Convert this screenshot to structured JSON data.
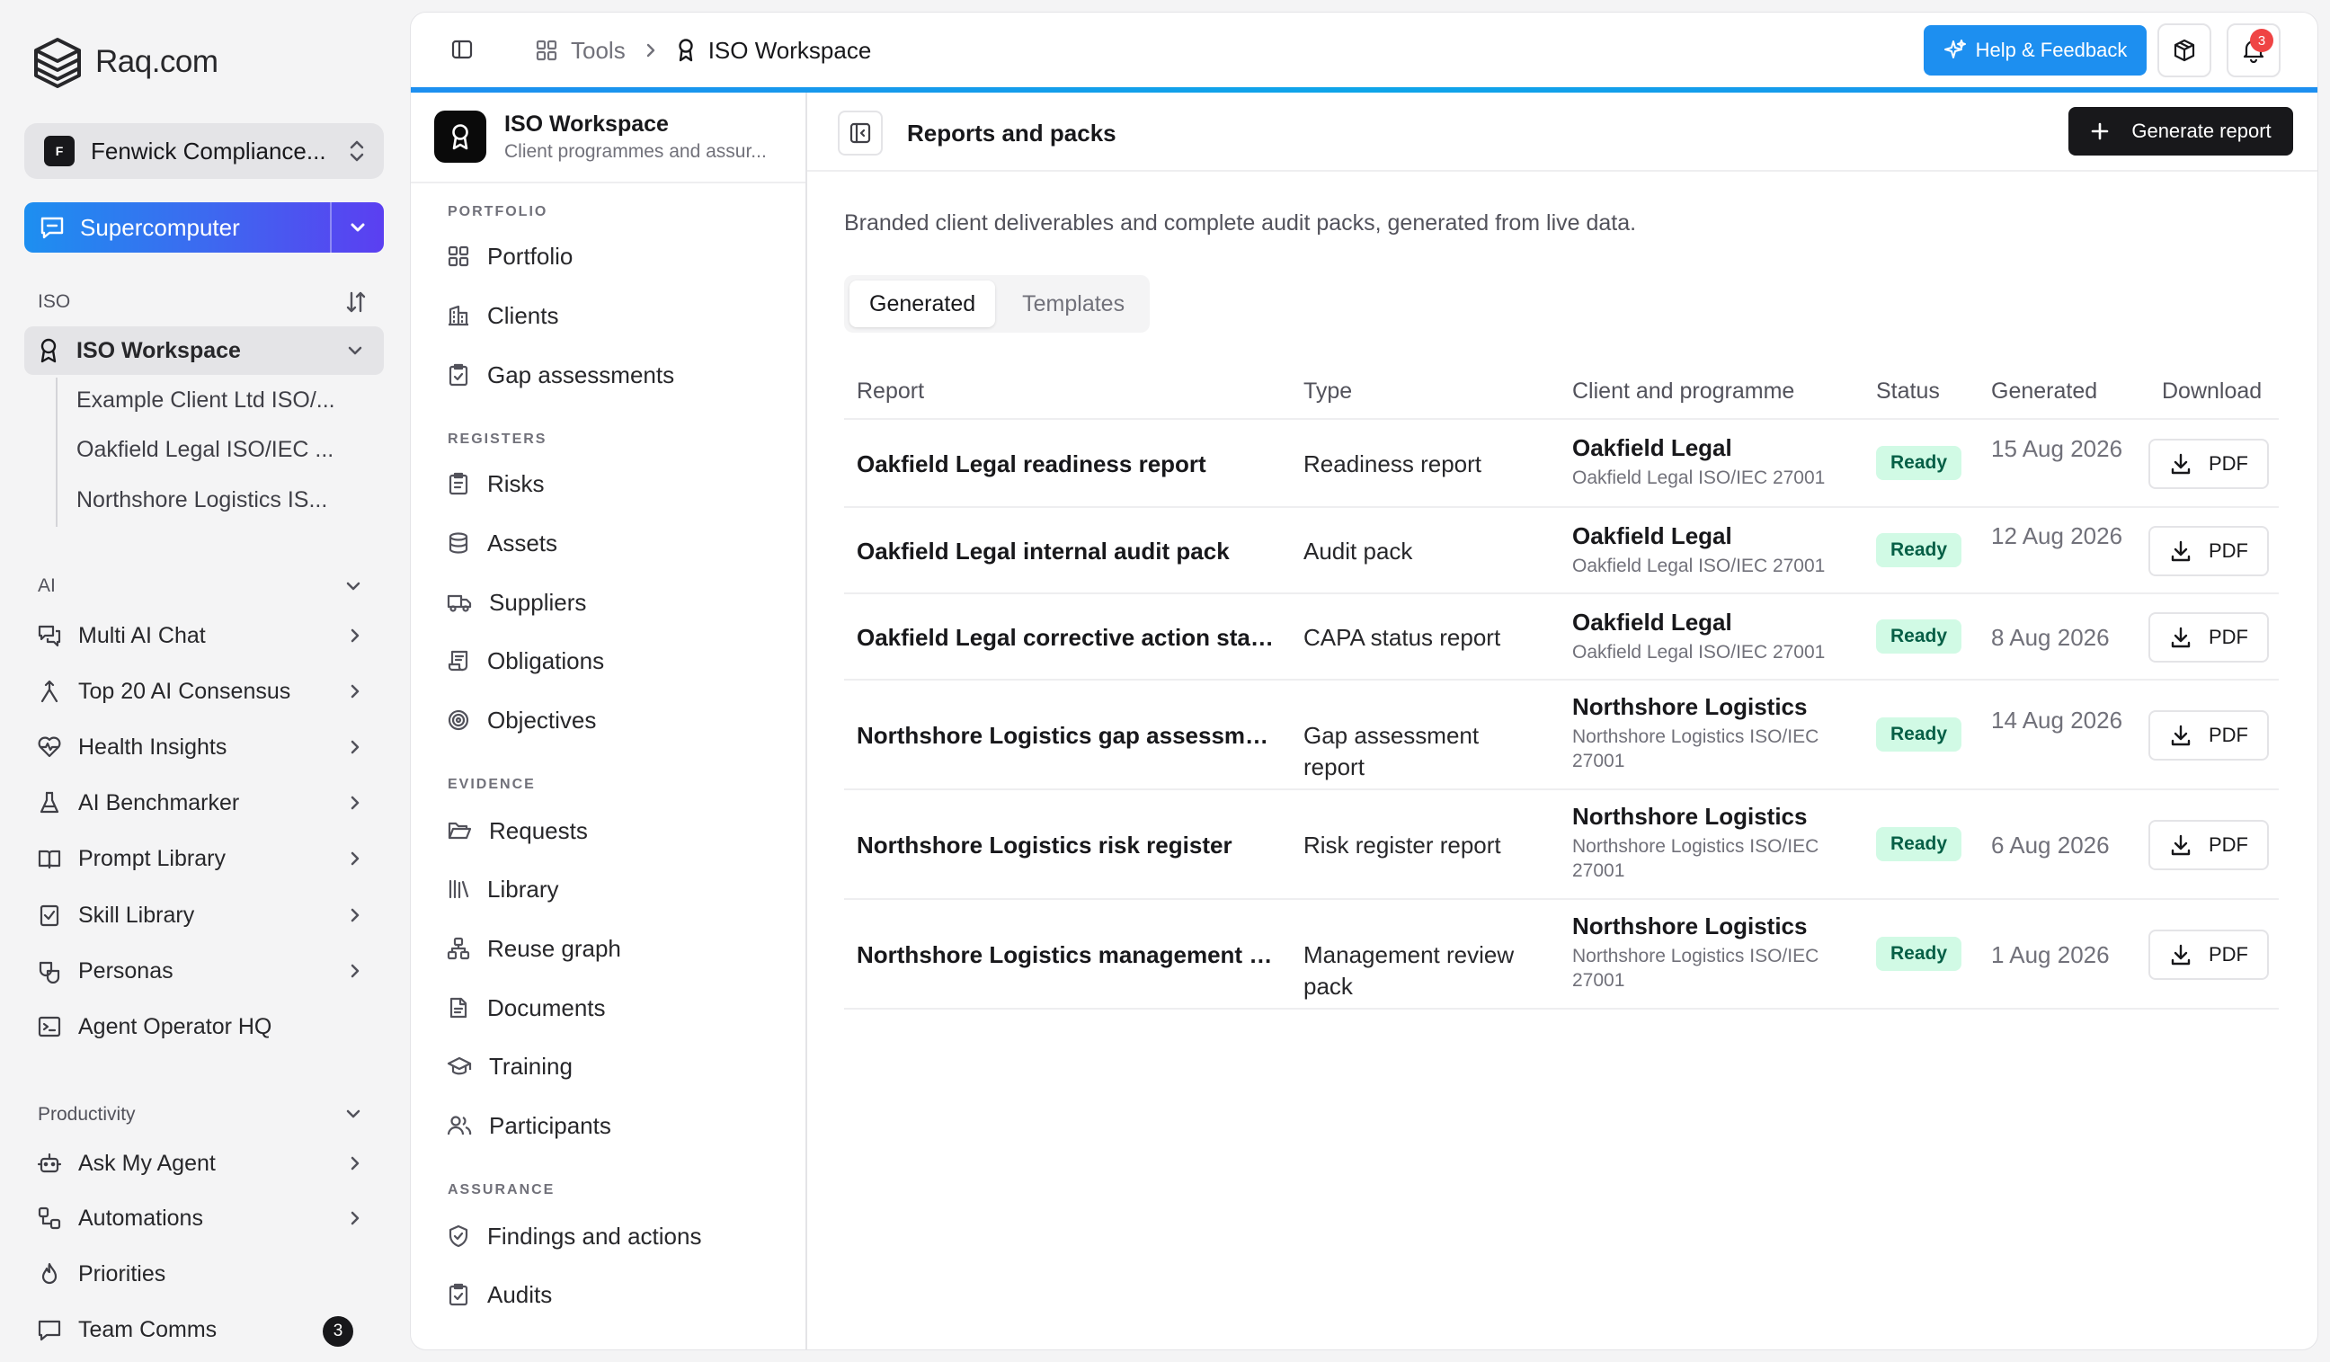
{
  "app": {
    "brand": "Raq.com",
    "workspace": {
      "initial": "F",
      "name": "Fenwick Compliance..."
    },
    "supercomputer_label": "Supercomputer",
    "sections": {
      "iso": "ISO",
      "ai": "AI",
      "productivity": "Productivity"
    },
    "iso_workspace": {
      "label": "ISO Workspace",
      "children": [
        "Example Client Ltd ISO/...",
        "Oakfield Legal ISO/IEC ...",
        "Northshore Logistics IS..."
      ]
    },
    "ai_items": [
      "Multi AI Chat",
      "Top 20 AI Consensus",
      "Health Insights",
      "AI Benchmarker",
      "Prompt Library",
      "Skill Library",
      "Personas",
      "Agent Operator HQ"
    ],
    "productivity_items": [
      "Ask My Agent",
      "Automations",
      "Priorities",
      "Team Comms"
    ],
    "team_comms_count": "3"
  },
  "topbar": {
    "crumb_tools": "Tools",
    "crumb_current": "ISO Workspace",
    "help_label": "Help & Feedback",
    "notification_count": "3"
  },
  "module": {
    "title": "ISO Workspace",
    "subtitle": "Client programmes and assur...",
    "groups": {
      "portfolio": {
        "label": "PORTFOLIO",
        "items": [
          "Portfolio",
          "Clients",
          "Gap assessments"
        ]
      },
      "registers": {
        "label": "REGISTERS",
        "items": [
          "Risks",
          "Assets",
          "Suppliers",
          "Obligations",
          "Objectives"
        ]
      },
      "evidence": {
        "label": "EVIDENCE",
        "items": [
          "Requests",
          "Library",
          "Reuse graph",
          "Documents",
          "Training",
          "Participants"
        ]
      },
      "assurance": {
        "label": "ASSURANCE",
        "items": [
          "Findings and actions",
          "Audits"
        ]
      }
    }
  },
  "content": {
    "title": "Reports and packs",
    "generate_label": "Generate report",
    "description": "Branded client deliverables and complete audit packs, generated from live data.",
    "tabs": [
      "Generated",
      "Templates"
    ],
    "columns": [
      "Report",
      "Type",
      "Client and programme",
      "Status",
      "Generated",
      "Download"
    ],
    "rows": [
      {
        "report": "Oakfield Legal readiness report",
        "type": "Readiness report",
        "client": "Oakfield Legal",
        "programme": "Oakfield Legal ISO/IEC 27001",
        "status": "Ready",
        "generated": "15 Aug 2026",
        "download": "PDF"
      },
      {
        "report": "Oakfield Legal internal audit pack",
        "type": "Audit pack",
        "client": "Oakfield Legal",
        "programme": "Oakfield Legal ISO/IEC 27001",
        "status": "Ready",
        "generated": "12 Aug 2026",
        "download": "PDF"
      },
      {
        "report": "Oakfield Legal corrective action status",
        "type": "CAPA status report",
        "client": "Oakfield Legal",
        "programme": "Oakfield Legal ISO/IEC 27001",
        "status": "Ready",
        "generated": "8 Aug 2026",
        "download": "PDF"
      },
      {
        "report": "Northshore Logistics gap assessment",
        "type": "Gap assessment report",
        "client": "Northshore Logistics",
        "programme": "Northshore Logistics ISO/IEC 27001",
        "status": "Ready",
        "generated": "14 Aug 2026",
        "download": "PDF"
      },
      {
        "report": "Northshore Logistics risk register",
        "type": "Risk register report",
        "client": "Northshore Logistics",
        "programme": "Northshore Logistics ISO/IEC 27001",
        "status": "Ready",
        "generated": "6 Aug 2026",
        "download": "PDF"
      },
      {
        "report": "Northshore Logistics management revi...",
        "type": "Management review pack",
        "client": "Northshore Logistics",
        "programme": "Northshore Logistics ISO/IEC 27001",
        "status": "Ready",
        "generated": "1 Aug 2026",
        "download": "PDF"
      }
    ]
  },
  "colors": {
    "accent_blue": "#1d8ff0",
    "supercomputer_gradient_end": "#5b3ff1",
    "ready_badge_bg": "#d1fae5",
    "ready_badge_text": "#065f46",
    "notification_red": "#ef4444"
  }
}
